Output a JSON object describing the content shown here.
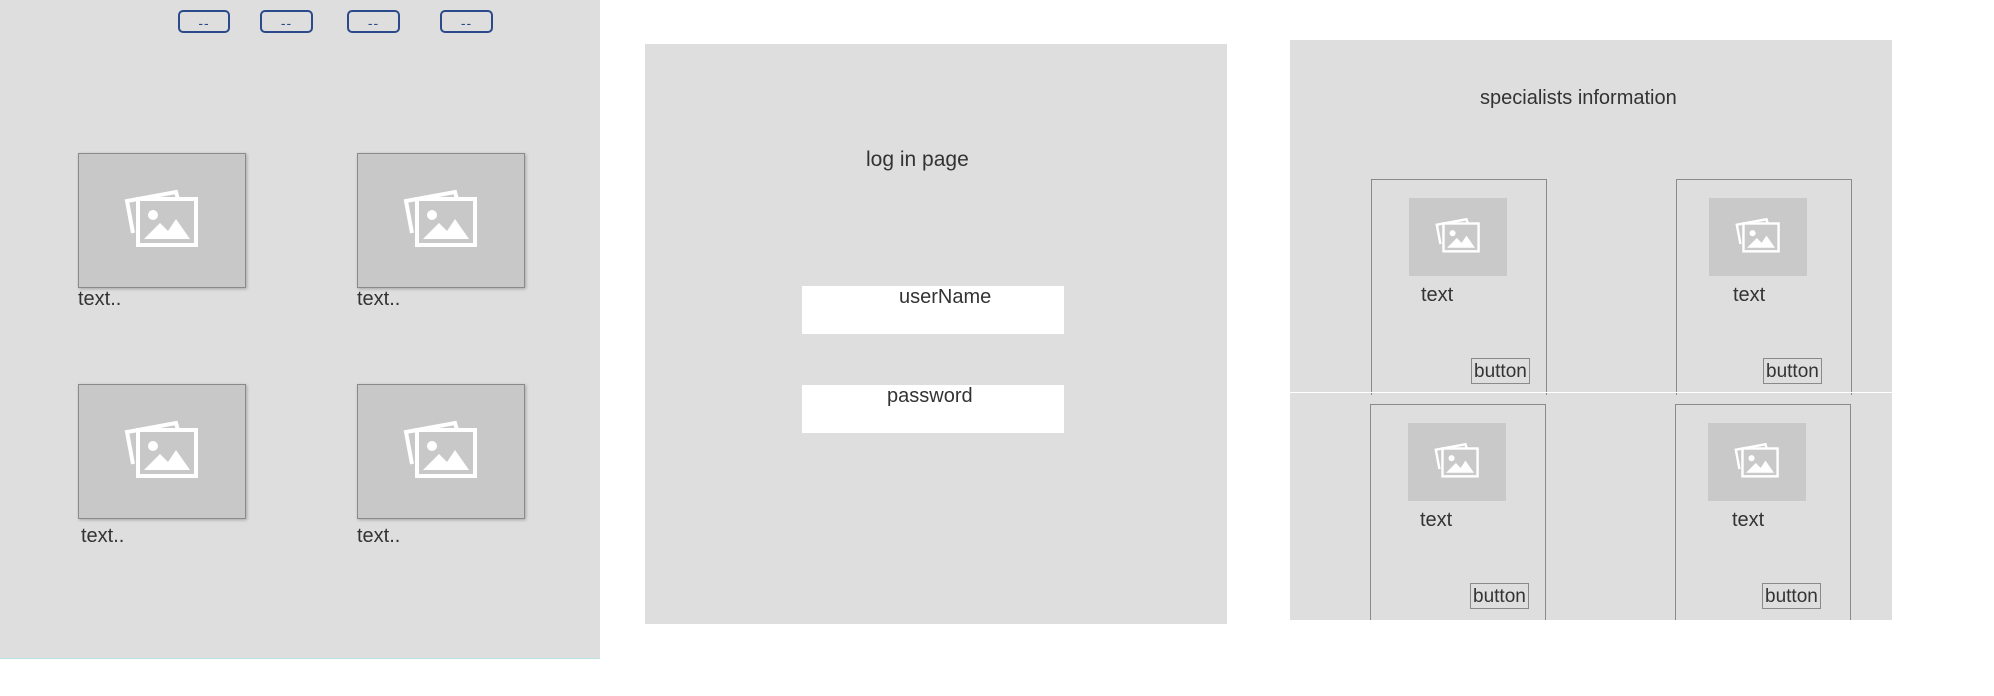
{
  "home": {
    "nav_buttons": [
      "--",
      "--",
      "--",
      "--"
    ],
    "cards": [
      {
        "icon": "image-placeholder-icon",
        "caption": "text.."
      },
      {
        "icon": "image-placeholder-icon",
        "caption": "text.."
      },
      {
        "icon": "image-placeholder-icon",
        "caption": "text.."
      },
      {
        "icon": "image-placeholder-icon",
        "caption": "text.."
      }
    ]
  },
  "login": {
    "title": "log in page",
    "username_label": "userName",
    "password_label": "password"
  },
  "specialists": {
    "title": "specialists information",
    "cards": [
      {
        "icon": "image-placeholder-icon",
        "text": "text",
        "button": "button"
      },
      {
        "icon": "image-placeholder-icon",
        "text": "text",
        "button": "button"
      },
      {
        "icon": "image-placeholder-icon",
        "text": "text",
        "button": "button"
      },
      {
        "icon": "image-placeholder-icon",
        "text": "text",
        "button": "button"
      }
    ]
  },
  "colors": {
    "panel_background": "#dedede",
    "nav_border": "#2c4a8a",
    "image_placeholder": "#c8c8c8"
  }
}
